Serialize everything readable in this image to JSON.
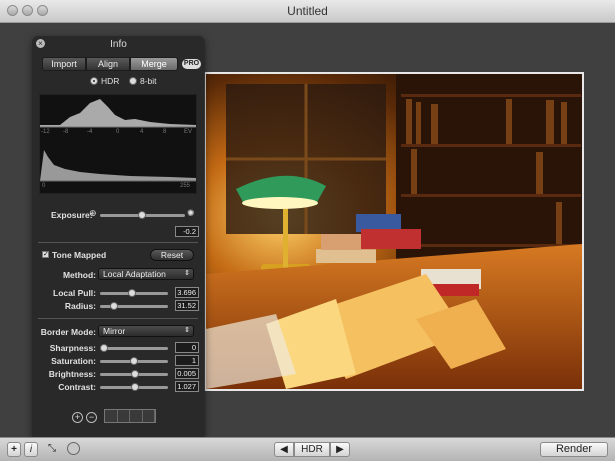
{
  "window": {
    "title": "Untitled"
  },
  "info_panel": {
    "title": "Info",
    "tabs": [
      {
        "label": "Import"
      },
      {
        "label": "Align"
      },
      {
        "label": "Merge",
        "active": true
      }
    ],
    "pro_badge": "PRO",
    "bit_depth": {
      "options": [
        "HDR",
        "8-bit"
      ],
      "selected": "HDR"
    },
    "histogram_top": {
      "ticks": [
        "-12",
        "-8",
        "-4",
        "0",
        "4",
        "8",
        "EV"
      ]
    },
    "histogram_bottom": {
      "ticks": [
        "0",
        "255"
      ]
    },
    "exposure": {
      "label": "Exposure:",
      "value": "-0.2"
    },
    "tone_mapped": {
      "label": "Tone Mapped",
      "checked": true,
      "reset_label": "Reset"
    },
    "method": {
      "label": "Method:",
      "value": "Local Adaptation"
    },
    "local_pull": {
      "label": "Local Pull:",
      "value": "3.696"
    },
    "radius": {
      "label": "Radius:",
      "value": "31.52"
    },
    "border_mode": {
      "label": "Border Mode:",
      "value": "Mirror"
    },
    "sharpness": {
      "label": "Sharpness:",
      "value": "0"
    },
    "saturation": {
      "label": "Saturation:",
      "value": "1"
    },
    "brightness": {
      "label": "Brightness:",
      "value": "0.005"
    },
    "contrast": {
      "label": "Contrast:",
      "value": "1.027"
    },
    "add_icon": "plus-icon",
    "remove_icon": "minus-icon"
  },
  "bottom_bar": {
    "add_label": "+",
    "info_label": "i",
    "nav_label": "HDR",
    "render_label": "Render"
  }
}
